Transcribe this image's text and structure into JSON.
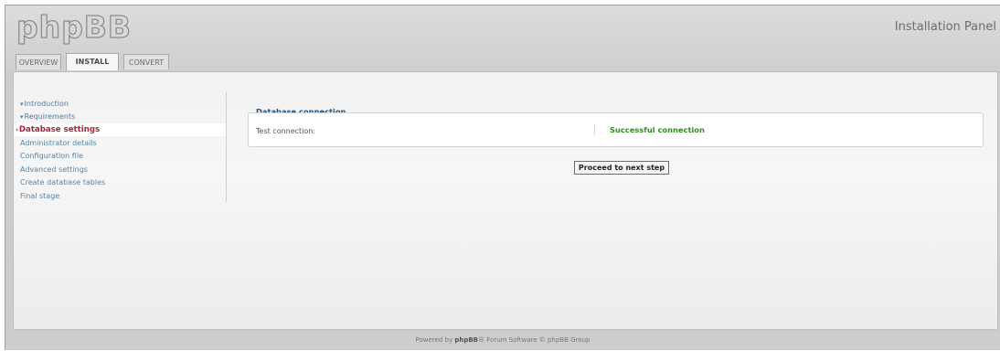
{
  "header": {
    "logo_text": "phpBB",
    "panel_title": "Installation Panel"
  },
  "tabs": [
    {
      "label": "OVERVIEW",
      "active": false
    },
    {
      "label": "INSTALL",
      "active": true
    },
    {
      "label": "CONVERT",
      "active": false
    }
  ],
  "sidebar": {
    "items": [
      {
        "label": "Introduction",
        "state": "done"
      },
      {
        "label": "Requirements",
        "state": "done"
      },
      {
        "label": "Database settings",
        "state": "current"
      },
      {
        "label": "Administrator details",
        "state": "pending"
      },
      {
        "label": "Configuration file",
        "state": "pending"
      },
      {
        "label": "Advanced settings",
        "state": "pending"
      },
      {
        "label": "Create database tables",
        "state": "pending"
      },
      {
        "label": "Final stage",
        "state": "pending"
      }
    ]
  },
  "main": {
    "legend": "Database connection",
    "test_label": "Test connection:",
    "test_result": "Successful connection",
    "proceed_label": "Proceed to next step"
  },
  "footer": {
    "prefix": "Powered by ",
    "brand": "phpBB",
    "suffix": "® Forum Software © phpBB Group"
  },
  "colors": {
    "accent": "#1f4e79",
    "current_step": "#a6263c",
    "success": "#2c8f1a",
    "link": "#5b83a3"
  }
}
